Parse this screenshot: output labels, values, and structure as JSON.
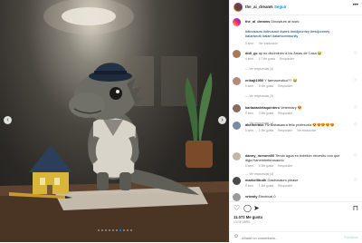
{
  "header": {
    "username": "the_ai_dreams",
    "separator": "•",
    "follow_label": "Seguir",
    "more_icon": "more-horizontal-icon"
  },
  "caption": {
    "username": "the_ai_dreams",
    "text": "Dinosaurs at work",
    "hashtags": "#dinosaurs #dinosaur #work #midjourney #midjourney #aiartwork #aiart #aiartcommunity",
    "time": "5 sem.",
    "translation": "Ver traducción"
  },
  "comments": [
    {
      "username": "didi_gc",
      "text": "ay no dicriminen a los Amas de Casa",
      "emoji": "😂",
      "time": "4 sem.",
      "likes": "17 Me gusta",
      "reply": "Responder",
      "replies": "— Ver respuestas (4)"
    },
    {
      "username": "erikajt1950",
      "text": "Y farmaceutico??",
      "emoji": "😂",
      "time": "5 sem.",
      "likes": "8 Me gusta",
      "reply": "Responder",
      "replies": "— Ver respuestas (2)"
    },
    {
      "username": "karladanielaquintero",
      "text": "Veterinary",
      "emoji": "😍",
      "time": "5 sem.",
      "likes": "3 Me gusta",
      "reply": "Responder",
      "replies": "— Ver respuestas (1)"
    },
    {
      "username": "abelheraso",
      "text": "Fiz Babasaura feliz profesoria",
      "emoji": "😍😍😍😍😍",
      "time": "5 sem.",
      "likes": "1 Me gusta",
      "reply": "Responder",
      "translation": "Ver traducción"
    },
    {
      "username": "danny_mreonn00",
      "text": "Tendo agua en botellón necesito uno que diga Hanemheterosaurio",
      "emoji": "",
      "time": "5 sem.",
      "likes": "6 Me gusta",
      "reply": "Responder",
      "replies": "— Ver respuestas (4)"
    },
    {
      "username": "marbellitudh",
      "text": "Gastrosauro please",
      "emoji": "",
      "time": "5 sem.",
      "likes": "1 Me gusta",
      "reply": "Responder"
    },
    {
      "username": "vrtewly",
      "text": "Electrical 0",
      "emoji": "",
      "time": "",
      "likes": "",
      "reply": ""
    }
  ],
  "actions": {
    "like_icon": "heart-icon",
    "comment_icon": "comment-bubble-icon",
    "share_icon": "paper-plane-icon",
    "save_icon": "bookmark-icon",
    "likes_text": "11.072 Me gusta",
    "date": "13 DE ABRIL"
  },
  "add_comment": {
    "emoji_icon": "smiley-icon",
    "placeholder": "Añade un comentario...",
    "publish_label": "Publicar"
  },
  "carousel": {
    "prev_icon": "chevron-left-icon",
    "next_icon": "chevron-right-icon",
    "slide_count": 10,
    "active_slide": 6
  },
  "colors": {
    "link": "#0095f6",
    "hashtag": "#00376b",
    "muted": "#8e8e8e",
    "text": "#262626"
  }
}
